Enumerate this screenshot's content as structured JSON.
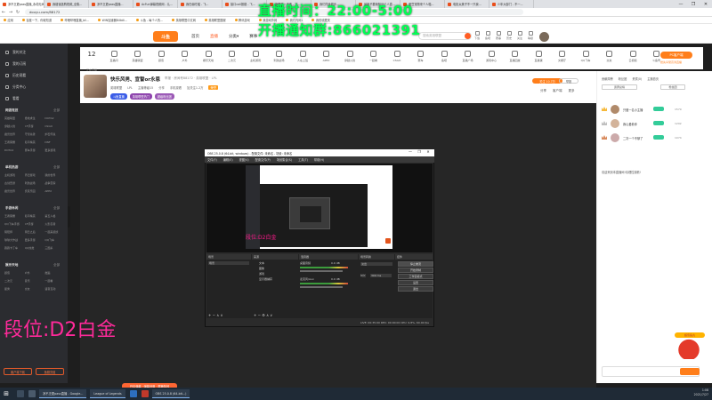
{
  "browser": {
    "tabs": [
      {
        "label": "凉不乏更pass直播_永劫无间...",
        "active": true
      },
      {
        "label": "我错误选购视频_全集...",
        "active": false
      },
      {
        "label": "凉不乏更pass直播...",
        "active": false
      },
      {
        "label": "AcFun弹幕视频网 - 认...",
        "active": false
      },
      {
        "label": "我在偷吃喵 - 飞...",
        "active": false
      },
      {
        "label": "接口call报错 - 飞...",
        "active": false
      },
      {
        "label": "我怪不一天收 - 飞...",
        "active": false
      },
      {
        "label": "我们同步同步...",
        "active": false
      },
      {
        "label": "最新不要我知只个人直...",
        "active": false
      },
      {
        "label": "爱豆宠物来个人喵...",
        "active": false
      },
      {
        "label": "电影太美子不一只我...",
        "active": false
      },
      {
        "label": "少年大部门 - 不一...",
        "active": false
      }
    ],
    "url": "douyu.com/88172",
    "bookmarks": [
      "应用",
      "百度一下，你就知道",
      "哔哩哔哩直播_bil...",
      "WIN加速器Bilibili...",
      "斗鱼 - 每个人的...",
      "英雄联盟中文网",
      "英雄联盟国服",
      "腾讯游戏",
      "我游戏外网",
      "我们内网1",
      "我的收藏夹"
    ],
    "window_controls": [
      "—",
      "❐",
      "✕"
    ]
  },
  "douyu": {
    "logo": "斗鱼",
    "nav": [
      {
        "label": "首页",
        "active": false
      },
      {
        "label": "直播",
        "active": true
      },
      {
        "label": "分类▾",
        "active": false
      },
      {
        "label": "赛事",
        "active": false
      }
    ],
    "search_placeholder": "搜索英雄联盟",
    "user_actions": [
      "下载",
      "鱼吧",
      "赛事",
      "历史",
      "关注",
      "等级"
    ]
  },
  "overlay": {
    "line1": "直播时间：22:00-5:00",
    "line2": "开播通知群:866021391"
  },
  "sidebar": {
    "items": [
      "我的关注",
      "我的订阅",
      "历史观看",
      "分类中心",
      "看看"
    ],
    "sections": [
      {
        "title": "网游竞技",
        "more": "全部",
        "games": [
          "英雄联盟",
          "绝地求生",
          "DOTA2",
          "穿越火线",
          "CF手游",
          "CSGO",
          "魔兽世界",
          "守望先锋",
          "炉石传说",
          "王者荣耀",
          "和平精英",
          "DNF",
          "DOTA2",
          "赛车手游",
          "更多游戏"
        ]
      },
      {
        "title": "单机热游",
        "more": "全部",
        "games": [
          "主机游戏",
          "怀旧游戏",
          "我的世界",
          "古剑奇谭",
          "刺激战场",
          "战争雷霆",
          "魔兽世界",
          "饥荒乐园",
          "APEX"
        ]
      },
      {
        "title": "手游休闲",
        "more": "全部",
        "games": [
          "王者荣耀",
          "和平精英",
          "第五人格",
          "QQ飞车手游",
          "CF手游",
          "火影忍者",
          "阴阳师",
          "明日之后",
          "一起来捉妖",
          "球球大作战",
          "更多手游",
          "QQ飞车",
          "跑跑卡丁车",
          "QQ炫舞",
          "三国杀"
        ]
      },
      {
        "title": "娱乐天地",
        "more": "全部",
        "games": [
          "颜值",
          "户外",
          "舞蹈",
          "二次元",
          "音乐",
          "一起看",
          "星秀",
          "交友",
          "语音互动"
        ]
      }
    ],
    "buttons": [
      "客户端下载",
      "鱼翅充值"
    ]
  },
  "categories": {
    "follow_count": "12",
    "follow_label": "正在直播",
    "items": [
      "直播间",
      "英雄联盟",
      "颜值",
      "户外",
      "娱乐天地",
      "二次元",
      "主机游戏",
      "刺激战场",
      "人在上班",
      "APEX",
      "穿越火线",
      "一起看",
      "CSGO",
      "赛车",
      "鱼吧",
      "直播广场",
      "游戏中心",
      "直播回放",
      "直播课",
      "文娱厅",
      "QQ飞车",
      "交友",
      "云视频",
      "斗鱼号"
    ],
    "pc_button": "PC客户端",
    "pc_sub": "抢先享受高清直播"
  },
  "room": {
    "title": "快乐风男、宣誓or永恩",
    "meta": "举报 · 房间号88172 · 英雄联盟 · LPL",
    "sub": [
      "英雄联盟",
      "LPL",
      "主播等级15",
      "分享",
      "手机观看",
      "加关注1.2万"
    ],
    "badge": "荣誉",
    "tags": [
      "斗鱼直播",
      "英雄联盟热门",
      "超级粉丝团"
    ],
    "right": [
      "分享",
      "客户端",
      "更多"
    ],
    "gift_pill": "关注 10.7万",
    "follow_pill": "举报"
  },
  "obs": {
    "title": "OBS 25.0.8 (64-bit, windows) - 配置文件: 未命名 - 场景: 未命名",
    "menu": [
      "文件(F)",
      "编辑(E)",
      "视图(V)",
      "配置文件(P)",
      "场景集合(S)",
      "工具(T)",
      "帮助(H)"
    ],
    "inner_text": "段位:D2白金",
    "panels": [
      "场景",
      "来源",
      "混音器",
      "场景转换",
      "控件"
    ],
    "scene": "场景",
    "sources": [
      "文本",
      "图像",
      "游戏",
      "显示器捕获"
    ],
    "mixer": [
      {
        "name": "桌面音频",
        "value": "0.0 dB"
      },
      {
        "name": "麦克风/Aux",
        "value": "0.0 dB"
      }
    ],
    "transition": {
      "label": "淡出",
      "duration_label": "时长",
      "duration": "300 ms"
    },
    "controls": [
      "停止推流",
      "开始录制",
      "工作室模式",
      "设置",
      "退出"
    ],
    "status": "LIVE: 00:35:00  REC: 00:00:00  CPU: 9.8%, 60.00 fps"
  },
  "rank_text": "段位:D2白金",
  "video_pill": "开启弹幕 · 弹幕设置 · 屏蔽特效",
  "right_panel": {
    "tabs": [
      "贡献周榜",
      "粉丝团",
      "贵宾(0)",
      "主播首页"
    ],
    "buttons": [
      "贵宾总榜",
      "粉丝团"
    ],
    "ranking": [
      {
        "name": "只做一名小主播",
        "score": "1579"
      },
      {
        "name": "我心爱着你",
        "score": "1292"
      },
      {
        "name": "二次一个不够了",
        "score": "1074"
      }
    ],
    "notice": "欢迎来到本直播间!请理性观看!",
    "gift_label": "超值鱼丸"
  },
  "taskbar": {
    "apps": [
      "凉不乏更pass直播 - Google...",
      "League of Legends",
      "OBS 25.0.8 (64-bit...)"
    ],
    "time": "1:08",
    "date": "2021/7/27"
  }
}
